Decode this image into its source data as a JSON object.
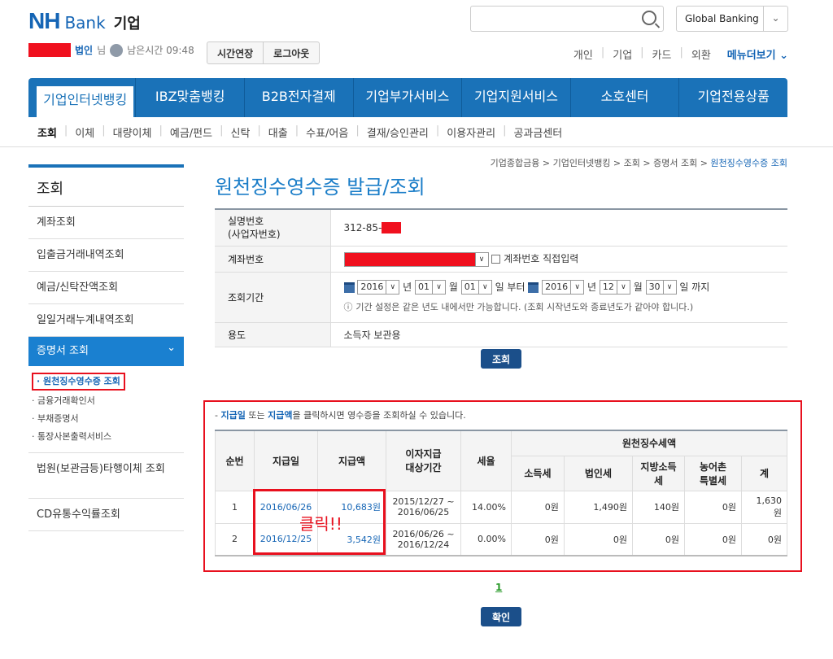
{
  "header": {
    "logo_nh": "NH",
    "logo_bank": "Bank",
    "logo_biz": "기업",
    "global_banking": "Global Banking",
    "user_suffix": "법인",
    "honorific": "님",
    "time_left_label": "남은시간 09:48",
    "extend_button": "시간연장",
    "logout_button": "로그아웃",
    "top_links": [
      "개인",
      "기업",
      "카드",
      "외환"
    ],
    "more_menu": "메뉴더보기 ⌄"
  },
  "nav": {
    "tabs": [
      "기업인터넷뱅킹",
      "IBZ맞춤뱅킹",
      "B2B전자결제",
      "기업부가서비스",
      "기업지원서비스",
      "소호센터",
      "기업전용상품"
    ]
  },
  "subnav": [
    "조회",
    "이체",
    "대량이체",
    "예금/펀드",
    "신탁",
    "대출",
    "수표/어음",
    "결재/승인관리",
    "이용자관리",
    "공과금센터"
  ],
  "sidebar": {
    "title": "조회",
    "items": [
      "계좌조회",
      "입출금거래내역조회",
      "예금/신탁잔액조회",
      "일일거래누계내역조회"
    ],
    "active": "증명서 조회",
    "subs": [
      "· 원천징수영수증 조회",
      "· 금융거래확인서",
      "· 부채증명서",
      "· 통장사본출력서비스"
    ],
    "after": [
      "법원(보관금등)타행이체 조회",
      "CD유통수익률조회"
    ]
  },
  "breadcrumb": [
    "기업종합금융 > ",
    "기업인터넷뱅킹 > ",
    "조회 > ",
    "증명서 조회 > "
  ],
  "breadcrumb_current": "원천징수영수증 조회",
  "page_title": "원천징수영수증 발급/조회",
  "form": {
    "id_label": "실명번호\n(사업자번호)",
    "id_value": "312-85-",
    "account_label": "계좌번호",
    "direct_input_label": "계좌번호 직접입력",
    "period_label": "조회기간",
    "from_year": "2016",
    "from_month": "01",
    "from_day": "01",
    "to_year": "2016",
    "to_month": "12",
    "to_day": "30",
    "u_year": "년",
    "u_month": "월",
    "u_day_from": "일 부터",
    "u_day_to": "일 까지",
    "period_note": "기간 설정은 같은 년도 내에서만 가능합니다. (조회 시작년도와 종료년도가 같아야 합니다.)",
    "usage_label": "용도",
    "usage_value": "소득자 보관용",
    "search_button": "조회"
  },
  "result": {
    "note_pre": "- ",
    "note_a": "지급일",
    "note_mid": " 또는 ",
    "note_b": "지급액",
    "note_post": "을 클릭하시면 영수증을 조회하실 수 있습니다.",
    "headers": {
      "no": "순번",
      "date": "지급일",
      "amount": "지급액",
      "period": "이자지급\n대상기간",
      "rate": "세율",
      "group": "원천징수세액",
      "income": "소득세",
      "corp": "법인세",
      "local": "지방소득세",
      "rural": "농어촌\n특별세",
      "total": "계"
    },
    "rows": [
      {
        "no": "1",
        "date": "2016/06/26",
        "amount": "10,683원",
        "period": "2015/12/27 ~\n2016/06/25",
        "rate": "14.00%",
        "income": "0원",
        "corp": "1,490원",
        "local": "140원",
        "rural": "0원",
        "total": "1,630\n원"
      },
      {
        "no": "2",
        "date": "2016/12/25",
        "amount": "3,542원",
        "period": "2016/06/26 ~\n2016/12/24",
        "rate": "0.00%",
        "income": "0원",
        "corp": "0원",
        "local": "0원",
        "rural": "0원",
        "total": "0원"
      }
    ],
    "click_annotation": "클릭!!",
    "page": "1",
    "confirm_button": "확인"
  }
}
